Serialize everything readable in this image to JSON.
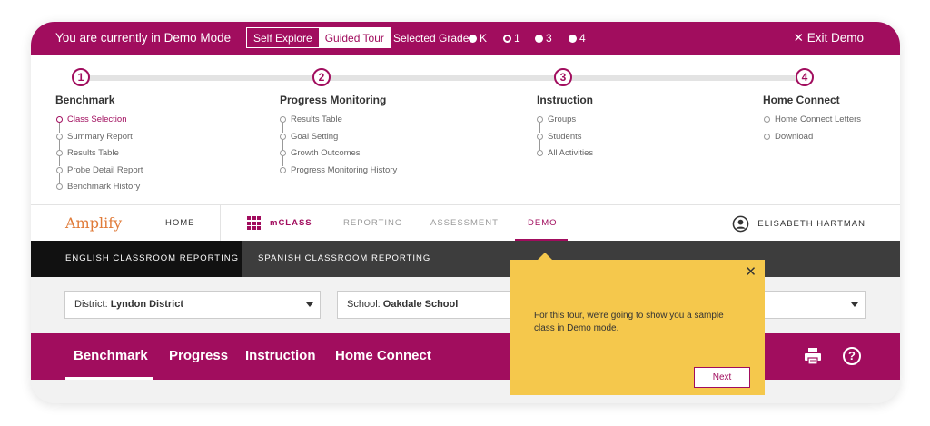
{
  "demo_bar": {
    "title": "You are currently in Demo Mode",
    "modes": [
      "Self Explore",
      "Guided Tour"
    ],
    "active_mode": "Guided Tour",
    "grade_label": "Selected Grade:",
    "grades": [
      "K",
      "1",
      "3",
      "4"
    ],
    "selected_grade": "1",
    "exit_label": "✕ Exit Demo"
  },
  "tour": {
    "steps": [
      {
        "number": "1",
        "title": "Benchmark",
        "items": [
          "Class Selection",
          "Summary Report",
          "Results Table",
          "Probe Detail Report",
          "Benchmark History"
        ]
      },
      {
        "number": "2",
        "title": "Progress Monitoring",
        "items": [
          "Results Table",
          "Goal Setting",
          "Growth Outcomes",
          "Progress Monitoring History"
        ]
      },
      {
        "number": "3",
        "title": "Instruction",
        "items": [
          "Groups",
          "Students",
          "All Activities"
        ]
      },
      {
        "number": "4",
        "title": "Home Connect",
        "items": [
          "Home Connect Letters",
          "Download"
        ]
      }
    ],
    "current_item": "Class Selection"
  },
  "nav": {
    "logo": "Amplify",
    "home": "HOME",
    "product": "mCLASS",
    "links": [
      "REPORTING",
      "ASSESSMENT",
      "DEMO"
    ],
    "active_link": "DEMO",
    "user": "ELISABETH HARTMAN"
  },
  "report_tabs": {
    "english": "ENGLISH CLASSROOM REPORTING",
    "spanish": "SPANISH CLASSROOM REPORTING",
    "active": "ENGLISH CLASSROOM REPORTING"
  },
  "filters": {
    "district_label": "District:",
    "district_value": "Lyndon District",
    "school_label": "School:",
    "school_value": "Oakdale School"
  },
  "main_tabs": [
    "Benchmark",
    "Progress",
    "Instruction",
    "Home Connect"
  ],
  "active_main_tab": "Benchmark",
  "popup": {
    "text": "For this tour, we're going to show you a sample class in Demo mode.",
    "close": "✕",
    "next": "Next"
  },
  "icons": {
    "print": "printer-icon",
    "help": "help-icon",
    "user": "user-icon",
    "apps": "grid-icon"
  },
  "colors": {
    "brand": "#a10d5e",
    "logo": "#e07b39",
    "popup": "#f5c84c",
    "dark_bar": "#3d3d3d"
  }
}
